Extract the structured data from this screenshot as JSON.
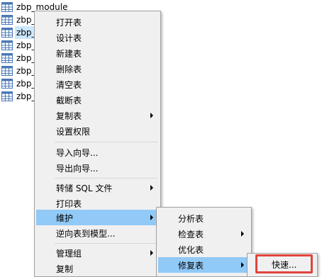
{
  "tree": {
    "items": [
      {
        "label": "zbp_module",
        "selected": false
      },
      {
        "label": "zbp_",
        "selected": true
      },
      {
        "label": "zbp_",
        "selected": false
      },
      {
        "label": "zbp_",
        "selected": false
      },
      {
        "label": "zbp_",
        "selected": false
      },
      {
        "label": "zbp_",
        "selected": false
      },
      {
        "label": "zbp_",
        "selected": false
      },
      {
        "label": "zbp_",
        "selected": false
      }
    ]
  },
  "context_menu": {
    "items": [
      {
        "label": "打开表"
      },
      {
        "label": "设计表"
      },
      {
        "label": "新建表"
      },
      {
        "label": "删除表"
      },
      {
        "label": "清空表"
      },
      {
        "label": "截断表"
      },
      {
        "label": "复制表",
        "submenu": true
      },
      {
        "label": "设置权限"
      },
      {
        "label": "导入向导..."
      },
      {
        "label": "导出向导..."
      },
      {
        "label": "转储 SQL 文件",
        "submenu": true
      },
      {
        "label": "打印表"
      },
      {
        "label": "维护",
        "submenu": true,
        "active": true
      },
      {
        "label": "逆向表到模型..."
      },
      {
        "label": "管理组",
        "submenu": true
      },
      {
        "label": "复制"
      }
    ]
  },
  "maintain_submenu": {
    "items": [
      {
        "label": "分析表"
      },
      {
        "label": "检查表",
        "submenu": true
      },
      {
        "label": "优化表"
      },
      {
        "label": "修复表",
        "submenu": true,
        "active": true
      }
    ]
  },
  "repair_submenu": {
    "items": [
      {
        "label": "快速..."
      }
    ]
  },
  "colors": {
    "menu_bg": "#f0f0f0",
    "active_bg": "#91c9f7",
    "selection_bg": "#cce8ff",
    "callout_border": "#e0443c"
  }
}
